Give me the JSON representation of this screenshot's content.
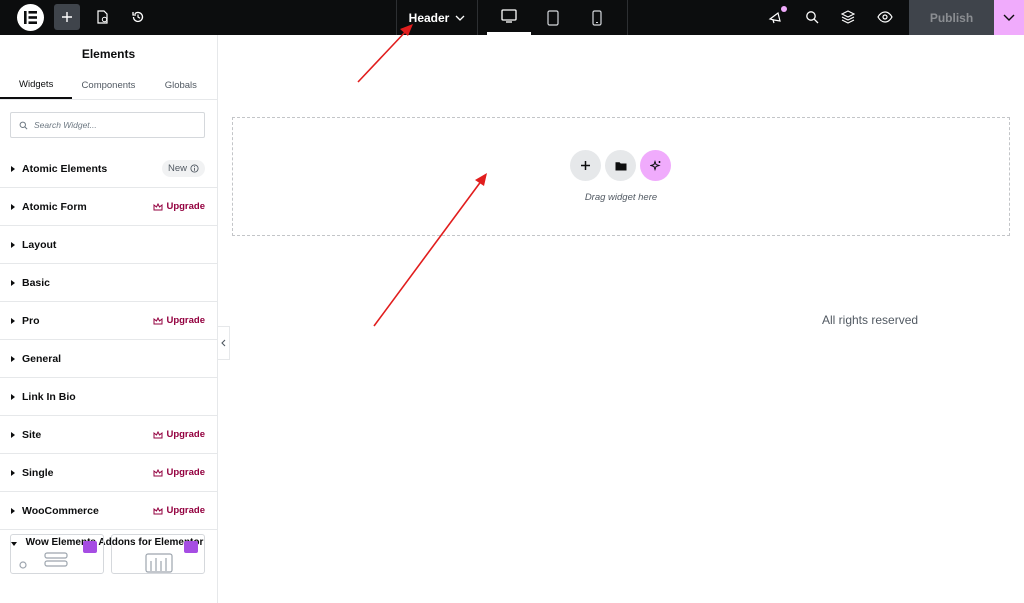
{
  "topbar": {
    "document_title": "Header",
    "publish_label": "Publish"
  },
  "panel": {
    "title": "Elements",
    "tabs": [
      "Widgets",
      "Components",
      "Globals"
    ],
    "search_placeholder": "Search Widget...",
    "categories": [
      {
        "label": "Atomic Elements",
        "badge": "New"
      },
      {
        "label": "Atomic Form",
        "badge": "Upgrade"
      },
      {
        "label": "Layout",
        "badge": ""
      },
      {
        "label": "Basic",
        "badge": ""
      },
      {
        "label": "Pro",
        "badge": "Upgrade"
      },
      {
        "label": "General",
        "badge": ""
      },
      {
        "label": "Link In Bio",
        "badge": ""
      },
      {
        "label": "Site",
        "badge": "Upgrade"
      },
      {
        "label": "Single",
        "badge": "Upgrade"
      },
      {
        "label": "WooCommerce",
        "badge": "Upgrade"
      }
    ],
    "expanded_category": "Wow Elements Addons for Elementor"
  },
  "canvas": {
    "dropzone_text": "Drag widget here",
    "footer_text": "All rights reserved"
  },
  "colors": {
    "topbar_bg": "#0c0d0e",
    "accent_pink": "#f0abfc",
    "upgrade": "#93003f",
    "annotation_arrow": "#e11d1d"
  }
}
